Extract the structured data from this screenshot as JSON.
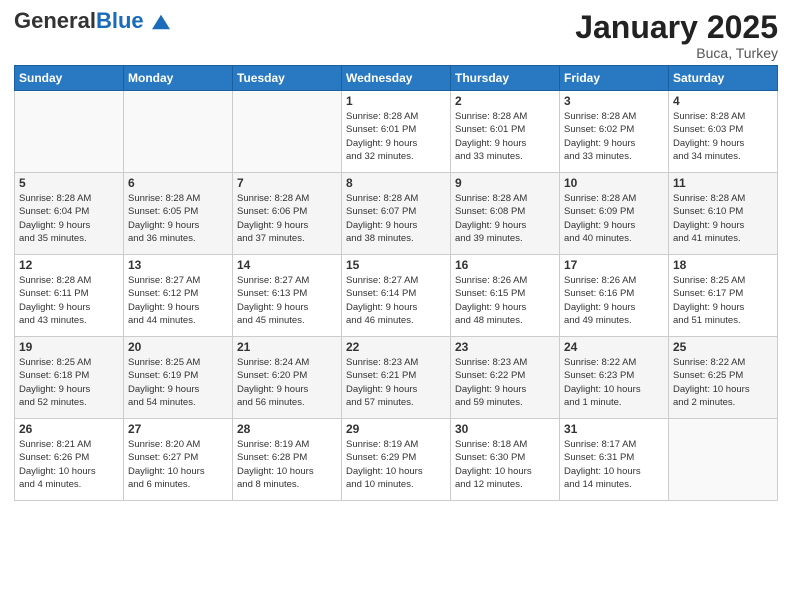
{
  "logo": {
    "general": "General",
    "blue": "Blue"
  },
  "header": {
    "title": "January 2025",
    "subtitle": "Buca, Turkey"
  },
  "days_of_week": [
    "Sunday",
    "Monday",
    "Tuesday",
    "Wednesday",
    "Thursday",
    "Friday",
    "Saturday"
  ],
  "weeks": [
    [
      {
        "day": "",
        "info": ""
      },
      {
        "day": "",
        "info": ""
      },
      {
        "day": "",
        "info": ""
      },
      {
        "day": "1",
        "info": "Sunrise: 8:28 AM\nSunset: 6:01 PM\nDaylight: 9 hours\nand 32 minutes."
      },
      {
        "day": "2",
        "info": "Sunrise: 8:28 AM\nSunset: 6:01 PM\nDaylight: 9 hours\nand 33 minutes."
      },
      {
        "day": "3",
        "info": "Sunrise: 8:28 AM\nSunset: 6:02 PM\nDaylight: 9 hours\nand 33 minutes."
      },
      {
        "day": "4",
        "info": "Sunrise: 8:28 AM\nSunset: 6:03 PM\nDaylight: 9 hours\nand 34 minutes."
      }
    ],
    [
      {
        "day": "5",
        "info": "Sunrise: 8:28 AM\nSunset: 6:04 PM\nDaylight: 9 hours\nand 35 minutes."
      },
      {
        "day": "6",
        "info": "Sunrise: 8:28 AM\nSunset: 6:05 PM\nDaylight: 9 hours\nand 36 minutes."
      },
      {
        "day": "7",
        "info": "Sunrise: 8:28 AM\nSunset: 6:06 PM\nDaylight: 9 hours\nand 37 minutes."
      },
      {
        "day": "8",
        "info": "Sunrise: 8:28 AM\nSunset: 6:07 PM\nDaylight: 9 hours\nand 38 minutes."
      },
      {
        "day": "9",
        "info": "Sunrise: 8:28 AM\nSunset: 6:08 PM\nDaylight: 9 hours\nand 39 minutes."
      },
      {
        "day": "10",
        "info": "Sunrise: 8:28 AM\nSunset: 6:09 PM\nDaylight: 9 hours\nand 40 minutes."
      },
      {
        "day": "11",
        "info": "Sunrise: 8:28 AM\nSunset: 6:10 PM\nDaylight: 9 hours\nand 41 minutes."
      }
    ],
    [
      {
        "day": "12",
        "info": "Sunrise: 8:28 AM\nSunset: 6:11 PM\nDaylight: 9 hours\nand 43 minutes."
      },
      {
        "day": "13",
        "info": "Sunrise: 8:27 AM\nSunset: 6:12 PM\nDaylight: 9 hours\nand 44 minutes."
      },
      {
        "day": "14",
        "info": "Sunrise: 8:27 AM\nSunset: 6:13 PM\nDaylight: 9 hours\nand 45 minutes."
      },
      {
        "day": "15",
        "info": "Sunrise: 8:27 AM\nSunset: 6:14 PM\nDaylight: 9 hours\nand 46 minutes."
      },
      {
        "day": "16",
        "info": "Sunrise: 8:26 AM\nSunset: 6:15 PM\nDaylight: 9 hours\nand 48 minutes."
      },
      {
        "day": "17",
        "info": "Sunrise: 8:26 AM\nSunset: 6:16 PM\nDaylight: 9 hours\nand 49 minutes."
      },
      {
        "day": "18",
        "info": "Sunrise: 8:25 AM\nSunset: 6:17 PM\nDaylight: 9 hours\nand 51 minutes."
      }
    ],
    [
      {
        "day": "19",
        "info": "Sunrise: 8:25 AM\nSunset: 6:18 PM\nDaylight: 9 hours\nand 52 minutes."
      },
      {
        "day": "20",
        "info": "Sunrise: 8:25 AM\nSunset: 6:19 PM\nDaylight: 9 hours\nand 54 minutes."
      },
      {
        "day": "21",
        "info": "Sunrise: 8:24 AM\nSunset: 6:20 PM\nDaylight: 9 hours\nand 56 minutes."
      },
      {
        "day": "22",
        "info": "Sunrise: 8:23 AM\nSunset: 6:21 PM\nDaylight: 9 hours\nand 57 minutes."
      },
      {
        "day": "23",
        "info": "Sunrise: 8:23 AM\nSunset: 6:22 PM\nDaylight: 9 hours\nand 59 minutes."
      },
      {
        "day": "24",
        "info": "Sunrise: 8:22 AM\nSunset: 6:23 PM\nDaylight: 10 hours\nand 1 minute."
      },
      {
        "day": "25",
        "info": "Sunrise: 8:22 AM\nSunset: 6:25 PM\nDaylight: 10 hours\nand 2 minutes."
      }
    ],
    [
      {
        "day": "26",
        "info": "Sunrise: 8:21 AM\nSunset: 6:26 PM\nDaylight: 10 hours\nand 4 minutes."
      },
      {
        "day": "27",
        "info": "Sunrise: 8:20 AM\nSunset: 6:27 PM\nDaylight: 10 hours\nand 6 minutes."
      },
      {
        "day": "28",
        "info": "Sunrise: 8:19 AM\nSunset: 6:28 PM\nDaylight: 10 hours\nand 8 minutes."
      },
      {
        "day": "29",
        "info": "Sunrise: 8:19 AM\nSunset: 6:29 PM\nDaylight: 10 hours\nand 10 minutes."
      },
      {
        "day": "30",
        "info": "Sunrise: 8:18 AM\nSunset: 6:30 PM\nDaylight: 10 hours\nand 12 minutes."
      },
      {
        "day": "31",
        "info": "Sunrise: 8:17 AM\nSunset: 6:31 PM\nDaylight: 10 hours\nand 14 minutes."
      },
      {
        "day": "",
        "info": ""
      }
    ]
  ]
}
